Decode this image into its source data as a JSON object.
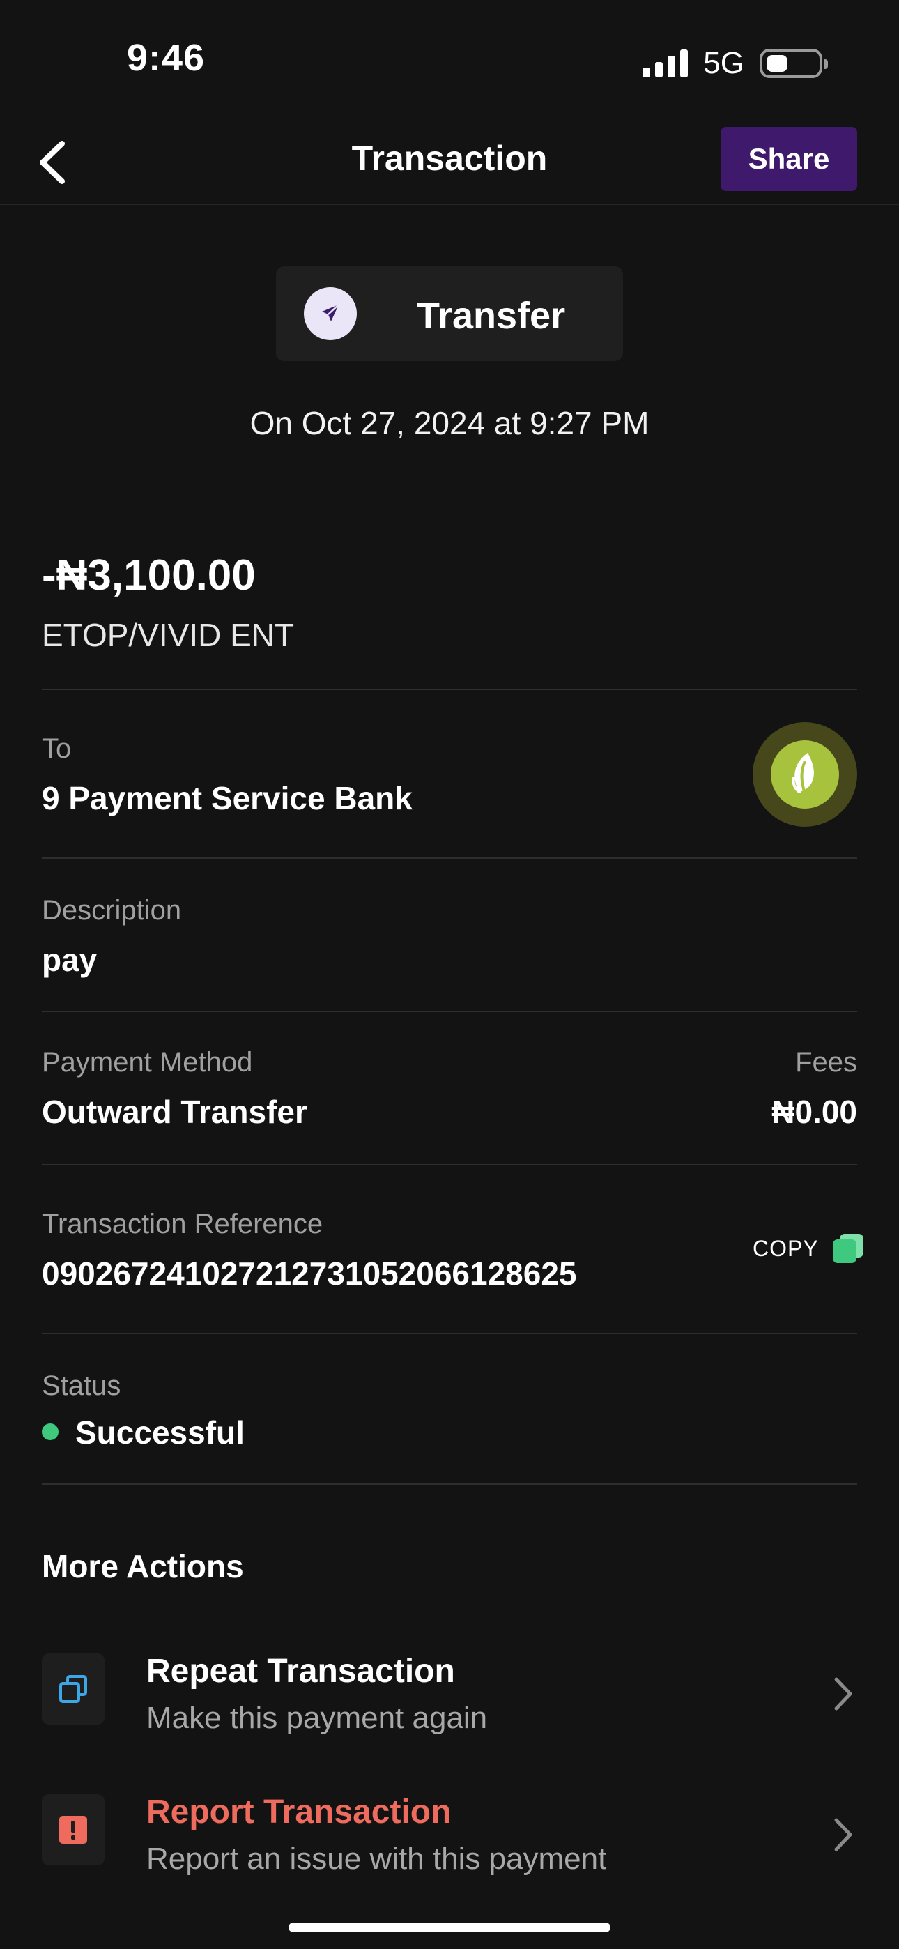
{
  "status_bar": {
    "time": "9:46",
    "network": "5G"
  },
  "header": {
    "title": "Transaction",
    "share_label": "Share",
    "back_icon": "chevron-left-icon"
  },
  "transaction": {
    "type_label": "Transfer",
    "type_icon": "paper-plane-icon",
    "date": "On Oct 27, 2024 at 9:27 PM",
    "amount": "-₦3,100.00",
    "counterparty": "ETOP/VIVID ENT"
  },
  "details": {
    "to_label": "To",
    "to_value": "9 Payment Service Bank",
    "bank_logo_icon": "leaf-icon",
    "description_label": "Description",
    "description_value": "pay",
    "payment_method_label": "Payment Method",
    "payment_method_value": "Outward Transfer",
    "fees_label": "Fees",
    "fees_value": "₦0.00",
    "reference_label": "Transaction Reference",
    "reference_value": "090267241027212731052066128625",
    "copy_label": "COPY",
    "status_label": "Status",
    "status_value": "Successful"
  },
  "more_actions": {
    "title": "More Actions",
    "items": [
      {
        "title": "Repeat Transaction",
        "subtitle": "Make this payment again",
        "icon": "repeat-copy-icon"
      },
      {
        "title": "Report Transaction",
        "subtitle": "Report an issue with this payment",
        "icon": "alert-icon"
      }
    ]
  },
  "colors": {
    "background": "#131313",
    "share_button": "#3f1a6c",
    "success": "#3ec97e",
    "report_red": "#ee6b5d",
    "repeat_blue": "#3fa6e6",
    "copy_green": "#4fd08a"
  }
}
